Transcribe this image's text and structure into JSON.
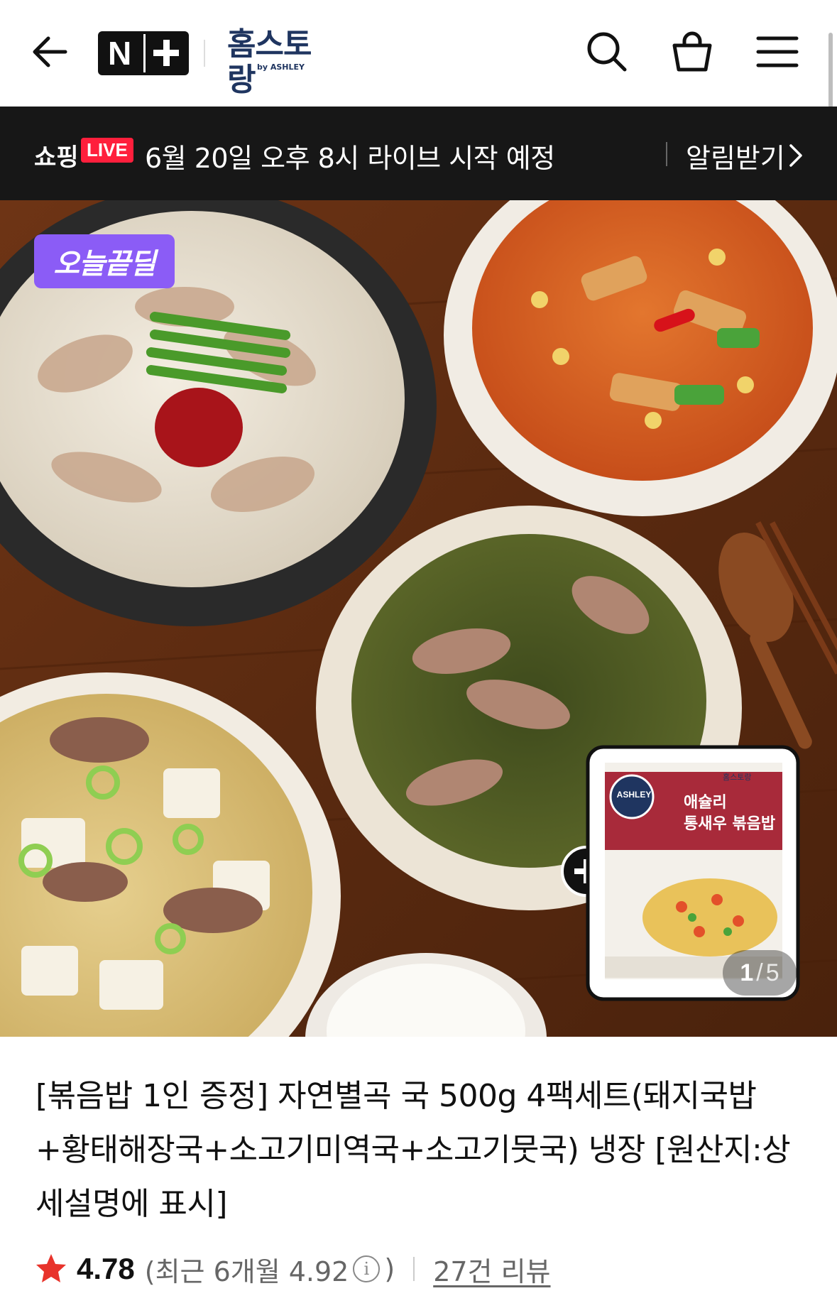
{
  "header": {
    "logo_text": "N+",
    "brand_name": "홈스토랑",
    "brand_sub": "by ASHLEY"
  },
  "live_banner": {
    "shop_label": "쇼핑",
    "live_label": "LIVE",
    "message": "6월 20일 오후 8시 라이브 시작 예정",
    "alarm_label": "알림받기"
  },
  "hero": {
    "badge": "오늘끝딜",
    "package": {
      "brand": "ASHLEY",
      "top_label": "홈스토랑",
      "name_line1": "애슐리",
      "name_line2": "통새우 볶음밥"
    },
    "counter_current": "1",
    "counter_separator": "/",
    "counter_total": "5"
  },
  "product": {
    "title": "[볶음밥 1인 증정] 자연별곡 국 500g 4팩세트(돼지국밥+황태해장국+소고기미역국+소고기뭇국) 냉장 [원산지:상세설명에 표시]",
    "rating": "4.78",
    "recent_open": "(최근 6개월 4.92",
    "recent_close": ")",
    "reviews": "27건 리뷰"
  },
  "colors": {
    "live_bar_bg": "#171717",
    "live_badge": "#ff1f3c",
    "today_badge": "#8b5cf6",
    "star": "#e8332b",
    "brand_navy": "#1f3560"
  }
}
